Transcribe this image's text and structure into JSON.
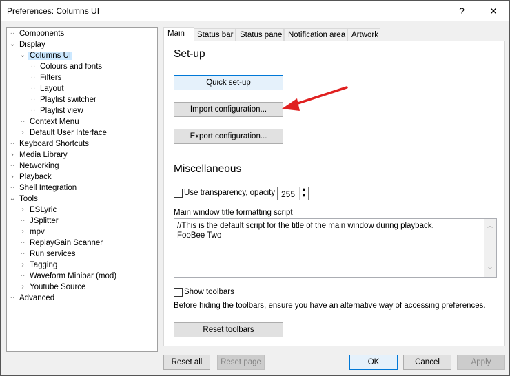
{
  "window": {
    "title": "Preferences: Columns UI",
    "help": "?",
    "close": "✕"
  },
  "tree": [
    {
      "label": "Components",
      "level": 0,
      "state": "leaf"
    },
    {
      "label": "Display",
      "level": 0,
      "state": "expanded"
    },
    {
      "label": "Columns UI",
      "level": 1,
      "state": "expanded",
      "selected": true
    },
    {
      "label": "Colours and fonts",
      "level": 2,
      "state": "leaf"
    },
    {
      "label": "Filters",
      "level": 2,
      "state": "leaf"
    },
    {
      "label": "Layout",
      "level": 2,
      "state": "leaf"
    },
    {
      "label": "Playlist switcher",
      "level": 2,
      "state": "leaf"
    },
    {
      "label": "Playlist view",
      "level": 2,
      "state": "leaf"
    },
    {
      "label": "Context Menu",
      "level": 1,
      "state": "leaf"
    },
    {
      "label": "Default User Interface",
      "level": 1,
      "state": "collapsed"
    },
    {
      "label": "Keyboard Shortcuts",
      "level": 0,
      "state": "leaf"
    },
    {
      "label": "Media Library",
      "level": 0,
      "state": "collapsed"
    },
    {
      "label": "Networking",
      "level": 0,
      "state": "leaf"
    },
    {
      "label": "Playback",
      "level": 0,
      "state": "collapsed"
    },
    {
      "label": "Shell Integration",
      "level": 0,
      "state": "leaf"
    },
    {
      "label": "Tools",
      "level": 0,
      "state": "expanded"
    },
    {
      "label": "ESLyric",
      "level": 1,
      "state": "collapsed"
    },
    {
      "label": "JSplitter",
      "level": 1,
      "state": "leaf"
    },
    {
      "label": "mpv",
      "level": 1,
      "state": "collapsed"
    },
    {
      "label": "ReplayGain Scanner",
      "level": 1,
      "state": "leaf"
    },
    {
      "label": "Run services",
      "level": 1,
      "state": "leaf"
    },
    {
      "label": "Tagging",
      "level": 1,
      "state": "collapsed"
    },
    {
      "label": "Waveform Minibar (mod)",
      "level": 1,
      "state": "leaf"
    },
    {
      "label": "Youtube Source",
      "level": 1,
      "state": "collapsed"
    },
    {
      "label": "Advanced",
      "level": 0,
      "state": "leaf"
    }
  ],
  "tabs": [
    "Main",
    "Status bar",
    "Status pane",
    "Notification area",
    "Artwork"
  ],
  "main": {
    "setup_heading": "Set-up",
    "quick_setup": "Quick set-up",
    "import": "Import configuration...",
    "export": "Export configuration...",
    "misc_heading": "Miscellaneous",
    "transparency_label": "Use transparency, opacity",
    "transparency_checked": false,
    "opacity": "255",
    "script_label": "Main window title formatting script",
    "script_lines": [
      "//This is the default script for the title of the main window during playback.",
      "FooBee Two"
    ],
    "show_toolbars_label": "Show toolbars",
    "show_toolbars_checked": false,
    "toolbars_note": "Before hiding the toolbars, ensure you have an alternative way of accessing preferences.",
    "reset_toolbars": "Reset toolbars"
  },
  "footer": {
    "reset_all": "Reset all",
    "reset_page": "Reset page",
    "ok": "OK",
    "cancel": "Cancel",
    "apply": "Apply"
  },
  "annotation": {
    "arrow_color": "#e02020"
  }
}
